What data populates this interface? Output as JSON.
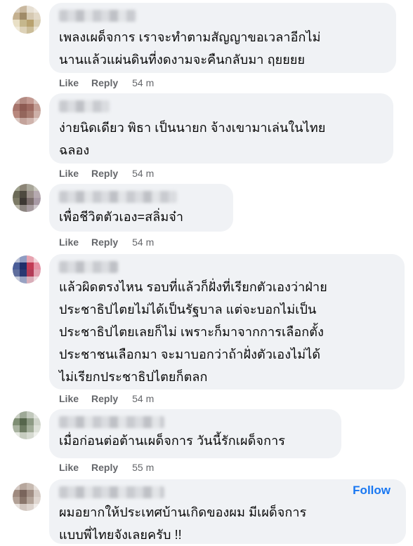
{
  "comments": [
    {
      "text": "เพลงเผด็จการ เราจะทำตามสัญญาขอเวลาอีกไม่\nนานแล้วแผ่นดินที่งดงามจะคืนกลับมา ฤยยยย",
      "like": "Like",
      "reply": "Reply",
      "time": "54 m"
    },
    {
      "text": "ง่ายนิดเดียว พิธา เป็นนายก จ้างเขามาเล่นในไทย\nฉลอง",
      "like": "Like",
      "reply": "Reply",
      "time": "54 m"
    },
    {
      "text": "เพื่อชีวิตตัวเอง=สลิ่มจ๋า",
      "like": "Like",
      "reply": "Reply",
      "time": "54 m"
    },
    {
      "text": "แล้วผิดตรงไหน รอบที่แล้วก็ฝั่งที่เรียกตัวเองว่าฝ่าย\nประชาธิปไตยไม่ได้เป็นรัฐบาล แต่จะบอกไม่เป็น\nประชาธิปไตยเลยก็ไม่ เพราะก็มาจากการเลือกตั้ง\nประชาชนเลือกมา จะมาบอกว่าถ้าฝั่งตัวเองไม่ได้\nไม่เรียกประชาธิปไตยก็ตลก",
      "like": "Like",
      "reply": "Reply",
      "time": "54 m"
    },
    {
      "text": "เมื่อก่อนต่อต้านเผด็จการ วันนี้รักเผด็จการ",
      "like": "Like",
      "reply": "Reply",
      "time": "55 m"
    },
    {
      "text": "ผมอยากให้ประเทศบ้านเกิดของผม มีเผด็จการ\nแบบพี่ไทยจังเลยครับ !!",
      "follow": "Follow"
    }
  ],
  "colors": {
    "bubble": "#f0f2f5",
    "meta": "#65676b",
    "link": "#1877f2"
  }
}
